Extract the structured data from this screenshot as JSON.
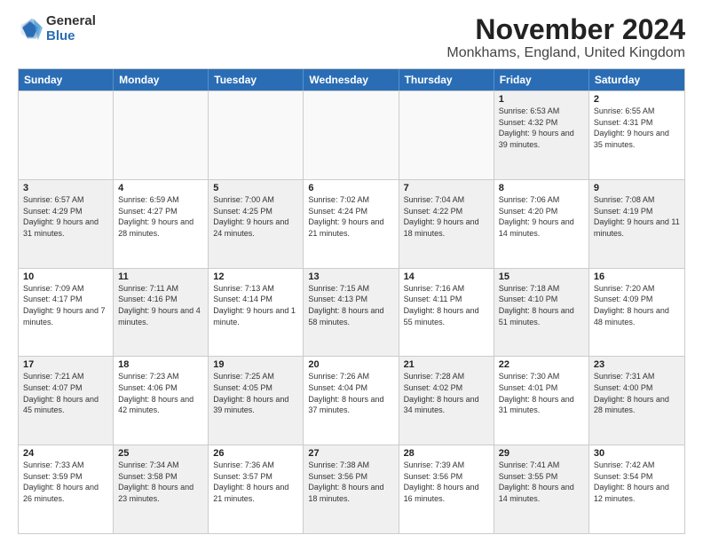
{
  "logo": {
    "general": "General",
    "blue": "Blue"
  },
  "title": {
    "month": "November 2024",
    "location": "Monkhams, England, United Kingdom"
  },
  "calendar": {
    "headers": [
      "Sunday",
      "Monday",
      "Tuesday",
      "Wednesday",
      "Thursday",
      "Friday",
      "Saturday"
    ],
    "rows": [
      [
        {
          "day": "",
          "text": "",
          "empty": true
        },
        {
          "day": "",
          "text": "",
          "empty": true
        },
        {
          "day": "",
          "text": "",
          "empty": true
        },
        {
          "day": "",
          "text": "",
          "empty": true
        },
        {
          "day": "",
          "text": "",
          "empty": true
        },
        {
          "day": "1",
          "text": "Sunrise: 6:53 AM\nSunset: 4:32 PM\nDaylight: 9 hours and 39 minutes.",
          "shaded": true
        },
        {
          "day": "2",
          "text": "Sunrise: 6:55 AM\nSunset: 4:31 PM\nDaylight: 9 hours and 35 minutes.",
          "shaded": false
        }
      ],
      [
        {
          "day": "3",
          "text": "Sunrise: 6:57 AM\nSunset: 4:29 PM\nDaylight: 9 hours and 31 minutes.",
          "shaded": true
        },
        {
          "day": "4",
          "text": "Sunrise: 6:59 AM\nSunset: 4:27 PM\nDaylight: 9 hours and 28 minutes.",
          "shaded": false
        },
        {
          "day": "5",
          "text": "Sunrise: 7:00 AM\nSunset: 4:25 PM\nDaylight: 9 hours and 24 minutes.",
          "shaded": true
        },
        {
          "day": "6",
          "text": "Sunrise: 7:02 AM\nSunset: 4:24 PM\nDaylight: 9 hours and 21 minutes.",
          "shaded": false
        },
        {
          "day": "7",
          "text": "Sunrise: 7:04 AM\nSunset: 4:22 PM\nDaylight: 9 hours and 18 minutes.",
          "shaded": true
        },
        {
          "day": "8",
          "text": "Sunrise: 7:06 AM\nSunset: 4:20 PM\nDaylight: 9 hours and 14 minutes.",
          "shaded": false
        },
        {
          "day": "9",
          "text": "Sunrise: 7:08 AM\nSunset: 4:19 PM\nDaylight: 9 hours and 11 minutes.",
          "shaded": true
        }
      ],
      [
        {
          "day": "10",
          "text": "Sunrise: 7:09 AM\nSunset: 4:17 PM\nDaylight: 9 hours and 7 minutes.",
          "shaded": false
        },
        {
          "day": "11",
          "text": "Sunrise: 7:11 AM\nSunset: 4:16 PM\nDaylight: 9 hours and 4 minutes.",
          "shaded": true
        },
        {
          "day": "12",
          "text": "Sunrise: 7:13 AM\nSunset: 4:14 PM\nDaylight: 9 hours and 1 minute.",
          "shaded": false
        },
        {
          "day": "13",
          "text": "Sunrise: 7:15 AM\nSunset: 4:13 PM\nDaylight: 8 hours and 58 minutes.",
          "shaded": true
        },
        {
          "day": "14",
          "text": "Sunrise: 7:16 AM\nSunset: 4:11 PM\nDaylight: 8 hours and 55 minutes.",
          "shaded": false
        },
        {
          "day": "15",
          "text": "Sunrise: 7:18 AM\nSunset: 4:10 PM\nDaylight: 8 hours and 51 minutes.",
          "shaded": true
        },
        {
          "day": "16",
          "text": "Sunrise: 7:20 AM\nSunset: 4:09 PM\nDaylight: 8 hours and 48 minutes.",
          "shaded": false
        }
      ],
      [
        {
          "day": "17",
          "text": "Sunrise: 7:21 AM\nSunset: 4:07 PM\nDaylight: 8 hours and 45 minutes.",
          "shaded": true
        },
        {
          "day": "18",
          "text": "Sunrise: 7:23 AM\nSunset: 4:06 PM\nDaylight: 8 hours and 42 minutes.",
          "shaded": false
        },
        {
          "day": "19",
          "text": "Sunrise: 7:25 AM\nSunset: 4:05 PM\nDaylight: 8 hours and 39 minutes.",
          "shaded": true
        },
        {
          "day": "20",
          "text": "Sunrise: 7:26 AM\nSunset: 4:04 PM\nDaylight: 8 hours and 37 minutes.",
          "shaded": false
        },
        {
          "day": "21",
          "text": "Sunrise: 7:28 AM\nSunset: 4:02 PM\nDaylight: 8 hours and 34 minutes.",
          "shaded": true
        },
        {
          "day": "22",
          "text": "Sunrise: 7:30 AM\nSunset: 4:01 PM\nDaylight: 8 hours and 31 minutes.",
          "shaded": false
        },
        {
          "day": "23",
          "text": "Sunrise: 7:31 AM\nSunset: 4:00 PM\nDaylight: 8 hours and 28 minutes.",
          "shaded": true
        }
      ],
      [
        {
          "day": "24",
          "text": "Sunrise: 7:33 AM\nSunset: 3:59 PM\nDaylight: 8 hours and 26 minutes.",
          "shaded": false
        },
        {
          "day": "25",
          "text": "Sunrise: 7:34 AM\nSunset: 3:58 PM\nDaylight: 8 hours and 23 minutes.",
          "shaded": true
        },
        {
          "day": "26",
          "text": "Sunrise: 7:36 AM\nSunset: 3:57 PM\nDaylight: 8 hours and 21 minutes.",
          "shaded": false
        },
        {
          "day": "27",
          "text": "Sunrise: 7:38 AM\nSunset: 3:56 PM\nDaylight: 8 hours and 18 minutes.",
          "shaded": true
        },
        {
          "day": "28",
          "text": "Sunrise: 7:39 AM\nSunset: 3:56 PM\nDaylight: 8 hours and 16 minutes.",
          "shaded": false
        },
        {
          "day": "29",
          "text": "Sunrise: 7:41 AM\nSunset: 3:55 PM\nDaylight: 8 hours and 14 minutes.",
          "shaded": true
        },
        {
          "day": "30",
          "text": "Sunrise: 7:42 AM\nSunset: 3:54 PM\nDaylight: 8 hours and 12 minutes.",
          "shaded": false
        }
      ]
    ]
  }
}
